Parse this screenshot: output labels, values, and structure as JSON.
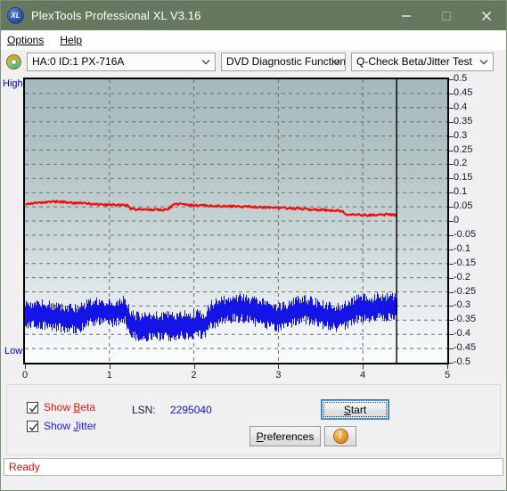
{
  "window": {
    "title": "PlexTools Professional XL V3.16",
    "app_icon": "xl-disc-icon",
    "minimize_label": "minimize-icon",
    "maximize_label": "maximize-icon",
    "close_label": "close-icon"
  },
  "menubar": {
    "items": [
      {
        "label": "Options",
        "mnemonic": "O"
      },
      {
        "label": "Help",
        "mnemonic": "H"
      }
    ]
  },
  "toolbar": {
    "drive_icon": "disc-icon",
    "drive_combo": "HA:0 ID:1  PX-716A",
    "function_combo": "DVD Diagnostic Functions",
    "test_combo": "Q-Check Beta/Jitter Test"
  },
  "chart_data": {
    "type": "line",
    "title": "",
    "xlabel": "",
    "ylabel": "",
    "xlim": [
      0,
      5
    ],
    "ylim": [
      -0.5,
      0.5
    ],
    "grid": true,
    "axis_high_label": "High",
    "axis_low_label": "Low",
    "xticks": [
      0,
      1,
      2,
      3,
      4,
      5
    ],
    "xtick_labels": [
      "0",
      "1",
      "2",
      "3",
      "4",
      "5"
    ],
    "yticks": [
      0.5,
      0.45,
      0.4,
      0.35,
      0.3,
      0.25,
      0.2,
      0.15,
      0.1,
      0.05,
      0,
      -0.05,
      -0.1,
      -0.15,
      -0.2,
      -0.25,
      -0.3,
      -0.35,
      -0.4,
      -0.45,
      -0.5
    ],
    "ytick_labels": [
      "0.5",
      "0.45",
      "0.4",
      "0.35",
      "0.3",
      "0.25",
      "0.2",
      "0.15",
      "0.1",
      "0.05",
      "0",
      "-0.05",
      "-0.1",
      "-0.15",
      "-0.2",
      "-0.25",
      "-0.3",
      "-0.35",
      "-0.4",
      "-0.45",
      "-0.5"
    ],
    "data_end_x": 4.4,
    "marker_line_x": 4.4,
    "series": [
      {
        "name": "Beta",
        "color": "#ee1111",
        "x": [
          0.0,
          0.08,
          0.16,
          0.24,
          0.32,
          0.4,
          0.48,
          0.56,
          0.64,
          0.72,
          0.8,
          0.88,
          0.96,
          1.04,
          1.12,
          1.2,
          1.24,
          1.28,
          1.36,
          1.44,
          1.52,
          1.6,
          1.68,
          1.76,
          1.84,
          1.92,
          2.0,
          2.08,
          2.12,
          2.16,
          2.24,
          2.32,
          2.4,
          2.48,
          2.56,
          2.64,
          2.72,
          2.8,
          2.88,
          2.96,
          3.04,
          3.12,
          3.2,
          3.28,
          3.36,
          3.44,
          3.52,
          3.6,
          3.68,
          3.76,
          3.8,
          3.84,
          3.92,
          4.0,
          4.08,
          4.16,
          4.24,
          4.32,
          4.4
        ],
        "y": [
          0.062,
          0.062,
          0.063,
          0.065,
          0.068,
          0.068,
          0.066,
          0.064,
          0.063,
          0.062,
          0.06,
          0.058,
          0.058,
          0.057,
          0.056,
          0.056,
          0.043,
          0.042,
          0.041,
          0.04,
          0.04,
          0.039,
          0.041,
          0.058,
          0.06,
          0.056,
          0.055,
          0.055,
          0.055,
          0.054,
          0.053,
          0.053,
          0.052,
          0.052,
          0.051,
          0.051,
          0.05,
          0.049,
          0.048,
          0.047,
          0.046,
          0.045,
          0.044,
          0.043,
          0.041,
          0.04,
          0.039,
          0.037,
          0.036,
          0.035,
          0.021,
          0.021,
          0.022,
          0.021,
          0.02,
          0.021,
          0.023,
          0.022,
          0.02
        ]
      },
      {
        "name": "Jitter",
        "color": "#1414e6",
        "x": [
          0.0,
          0.1,
          0.2,
          0.3,
          0.4,
          0.5,
          0.6,
          0.7,
          0.8,
          0.9,
          1.0,
          1.1,
          1.18,
          1.25,
          1.35,
          1.45,
          1.55,
          1.65,
          1.75,
          1.85,
          1.95,
          2.05,
          2.12,
          2.2,
          2.3,
          2.4,
          2.5,
          2.6,
          2.7,
          2.8,
          2.9,
          3.0,
          3.1,
          3.2,
          3.3,
          3.4,
          3.5,
          3.6,
          3.7,
          3.8,
          3.9,
          4.0,
          4.1,
          4.2,
          4.3,
          4.4
        ],
        "y": [
          -0.335,
          -0.33,
          -0.33,
          -0.335,
          -0.34,
          -0.345,
          -0.345,
          -0.335,
          -0.318,
          -0.32,
          -0.325,
          -0.32,
          -0.312,
          -0.368,
          -0.372,
          -0.375,
          -0.372,
          -0.37,
          -0.372,
          -0.368,
          -0.366,
          -0.362,
          -0.37,
          -0.33,
          -0.322,
          -0.31,
          -0.305,
          -0.31,
          -0.318,
          -0.325,
          -0.332,
          -0.34,
          -0.33,
          -0.318,
          -0.312,
          -0.32,
          -0.328,
          -0.335,
          -0.342,
          -0.33,
          -0.312,
          -0.305,
          -0.31,
          -0.302,
          -0.305,
          -0.3
        ],
        "band": 0.045
      }
    ]
  },
  "controls": {
    "show_beta": {
      "label_pre": "Show ",
      "label_mnemonic": "B",
      "label_post": "eta",
      "checked": true
    },
    "show_jitter": {
      "label_pre": "Show ",
      "label_mnemonic": "J",
      "label_post": "itter",
      "checked": true
    },
    "lsn_label": "LSN:",
    "lsn_value": "2295040",
    "start_pre": "",
    "start_mnemonic": "S",
    "start_post": "tart",
    "prefs_pre": "",
    "prefs_mnemonic": "P",
    "prefs_post": "references",
    "info_glyph": "i"
  },
  "statusbar": {
    "text": "Ready"
  }
}
